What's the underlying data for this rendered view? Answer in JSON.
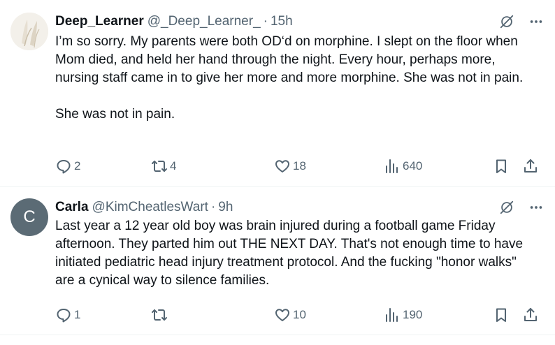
{
  "posts": [
    {
      "author_name": "Deep_Learner",
      "handle": "@_Deep_Learner_",
      "separator": "·",
      "time": "15h",
      "avatar_style": "photo-light",
      "paragraphs": [
        "I’m so sorry. My parents were both OD‘d on morphine. I slept on the floor when Mom died, and held her hand through the night. Every hour, perhaps more, nursing staff came in to give her more and more morphine. She was not in pain.",
        "She was not in pain."
      ],
      "replies": "2",
      "reposts": "4",
      "likes": "18",
      "views": "640"
    },
    {
      "author_name": "Carla",
      "handle": "@KimCheatlesWart",
      "separator": "·",
      "time": "9h",
      "avatar_letter": "C",
      "avatar_color": "#5b6b75",
      "paragraphs": [
        "Last year a 12 year old boy was brain injured during a football game Friday afternoon. They parted him out THE NEXT DAY. That's not enough time to have initiated pediatric head injury treatment protocol. And the fucking \"honor walks\" are a cynical way to silence families."
      ],
      "replies": "1",
      "reposts": "",
      "likes": "10",
      "views": "190"
    }
  ],
  "icons": {
    "grok": "grok-icon",
    "more": "more-icon",
    "reply": "reply-icon",
    "repost": "repost-icon",
    "like": "heart-icon",
    "views": "views-icon",
    "bookmark": "bookmark-icon",
    "share": "share-icon"
  },
  "colors": {
    "text": "#0f1419",
    "secondary": "#536471",
    "divider": "#eff3f4"
  }
}
